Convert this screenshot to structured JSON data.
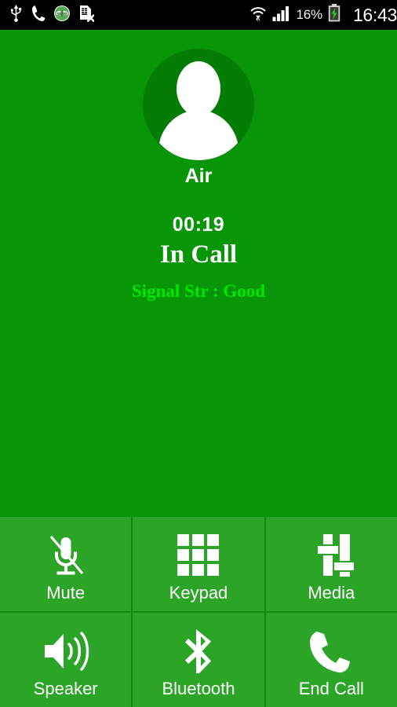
{
  "status_bar": {
    "left_icons": [
      {
        "name": "usb-icon",
        "label": "USB connected"
      },
      {
        "name": "call-icon",
        "label": "Ongoing call"
      },
      {
        "name": "app-notification-icon",
        "label": "App notification"
      },
      {
        "name": "sim-card-error-icon",
        "label": "SIM card removed"
      }
    ],
    "right_icons": [
      {
        "name": "wifi-icon",
        "label": "Wi-Fi"
      },
      {
        "name": "cellular-signal-icon",
        "label": "Cellular signal"
      },
      {
        "name": "battery-charging-icon",
        "label": "Battery charging"
      }
    ],
    "battery_percent": "16%",
    "clock": "16:43",
    "background_color": "#000000",
    "text_color": "#ffffff"
  },
  "call": {
    "avatar_icon": "person-avatar-icon",
    "contact_name": "Air",
    "timer": "00:19",
    "state": "In Call",
    "signal_strength": "Signal Str : Good",
    "signal_color": "#00e800",
    "background_color": "#089608"
  },
  "buttons": {
    "panel_color": "#2ba428",
    "divider_color": "#148c14",
    "rows": [
      [
        {
          "label": "Mute",
          "icon": "microphone-off-icon"
        },
        {
          "label": "Keypad",
          "icon": "dialpad-grid-icon"
        },
        {
          "label": "Media",
          "icon": "equalizer-sliders-icon"
        }
      ],
      [
        {
          "label": "Speaker",
          "icon": "speaker-loud-icon"
        },
        {
          "label": "Bluetooth",
          "icon": "bluetooth-icon"
        },
        {
          "label": "End Call",
          "icon": "phone-handset-icon"
        }
      ]
    ]
  }
}
